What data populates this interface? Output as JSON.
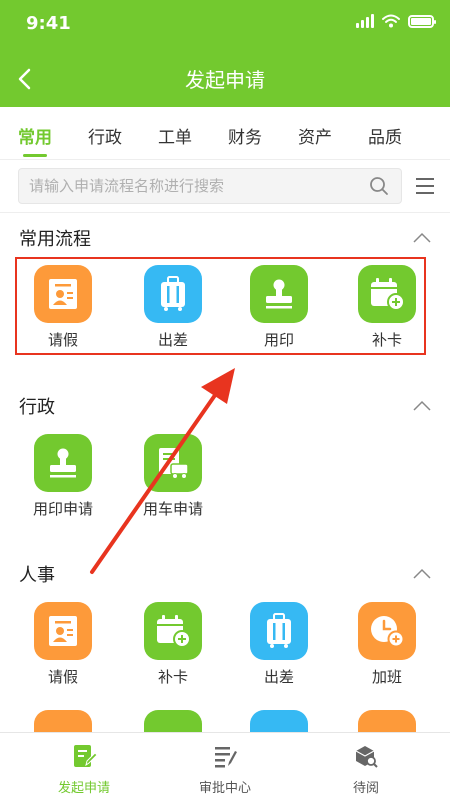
{
  "status": {
    "time": "9:41"
  },
  "header": {
    "title": "发起申请"
  },
  "tabs": [
    {
      "label": "常用",
      "active": true
    },
    {
      "label": "行政",
      "active": false
    },
    {
      "label": "工单",
      "active": false
    },
    {
      "label": "财务",
      "active": false
    },
    {
      "label": "资产",
      "active": false
    },
    {
      "label": "品质",
      "active": false
    }
  ],
  "search": {
    "placeholder": "请输入申请流程名称进行搜索"
  },
  "sections": {
    "common": {
      "title": "常用流程",
      "items": [
        {
          "label": "请假",
          "icon": "leave-icon",
          "color": "#fd9a3a"
        },
        {
          "label": "出差",
          "icon": "suitcase-icon",
          "color": "#36b9f3"
        },
        {
          "label": "用印",
          "icon": "stamp-icon",
          "color": "#73c92f"
        },
        {
          "label": "补卡",
          "icon": "calendar-add-icon",
          "color": "#73c92f"
        }
      ]
    },
    "admin": {
      "title": "行政",
      "items": [
        {
          "label": "用印申请",
          "icon": "stamp-icon",
          "color": "#73c92f"
        },
        {
          "label": "用车申请",
          "icon": "vehicle-icon",
          "color": "#73c92f"
        }
      ]
    },
    "hr": {
      "title": "人事",
      "items": [
        {
          "label": "请假",
          "icon": "leave-icon",
          "color": "#fd9a3a"
        },
        {
          "label": "补卡",
          "icon": "calendar-add-icon",
          "color": "#73c92f"
        },
        {
          "label": "出差",
          "icon": "suitcase-icon",
          "color": "#36b9f3"
        },
        {
          "label": "加班",
          "icon": "overtime-clock-icon",
          "color": "#fd9a3a"
        }
      ]
    }
  },
  "bottom_nav": [
    {
      "label": "发起申请",
      "icon": "edit-icon",
      "active": true
    },
    {
      "label": "审批中心",
      "icon": "approve-icon",
      "active": false
    },
    {
      "label": "待阅",
      "icon": "inbox-icon",
      "active": false
    }
  ],
  "colors": {
    "primary": "#73c92f",
    "highlight": "#e8341f",
    "orange": "#fd9a3a",
    "blue": "#36b9f3"
  }
}
